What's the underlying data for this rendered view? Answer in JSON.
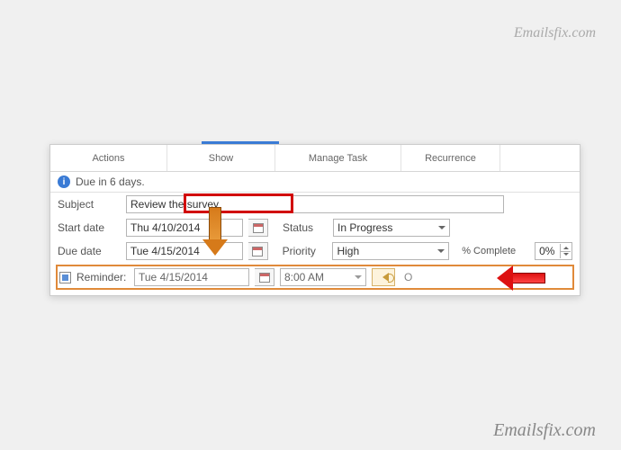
{
  "watermark": "Emailsfix.com",
  "ribbon": {
    "actions": "Actions",
    "show": "Show",
    "manage": "Manage Task",
    "recurrence": "Recurrence"
  },
  "infobar": {
    "text": "Due in 6 days."
  },
  "fields": {
    "subject_label": "Subject",
    "subject_value": "Review the survey",
    "start_label": "Start date",
    "start_value": "Thu 4/10/2014",
    "due_label": "Due date",
    "due_value": "Tue 4/15/2014",
    "status_label": "Status",
    "status_value": "In Progress",
    "priority_label": "Priority",
    "priority_value": "High",
    "pct_label": "% Complete",
    "pct_value": "0%"
  },
  "reminder": {
    "label": "Reminder:",
    "date": "Tue 4/15/2014",
    "time": "8:00 AM",
    "cutoff": "O"
  }
}
